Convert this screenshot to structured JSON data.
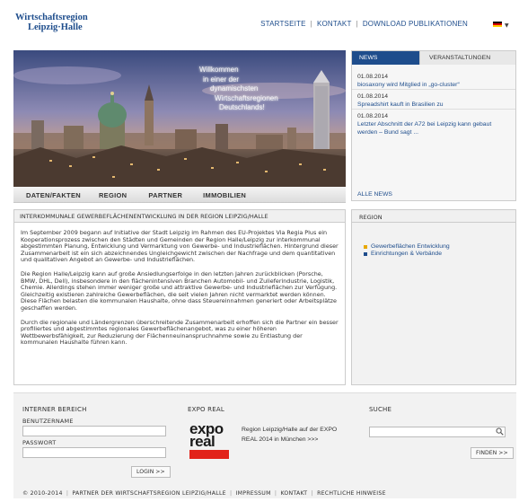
{
  "header": {
    "logo_line1": "Wirtschaftsregion",
    "logo_line2": "Leipzig·Halle",
    "nav": [
      "STARTSEITE",
      "KONTAKT",
      "DOWNLOAD PUBLIKATIONEN"
    ],
    "language_flag": "de-flag-icon"
  },
  "hero": {
    "text_lines": [
      "Willkommen",
      "in einer der",
      "dynamischsten",
      "Wirtschaftsregionen",
      "Deutschlands!"
    ],
    "nav": [
      "DATEN/FAKTEN",
      "REGION",
      "PARTNER",
      "IMMOBILIEN"
    ]
  },
  "news": {
    "tabs": [
      "NEWS",
      "VERANSTALTUNGEN"
    ],
    "items": [
      {
        "date": "01.08.2014",
        "text": "biosaxony wird Mitglied in „go-cluster“"
      },
      {
        "date": "01.08.2014",
        "text": "Spreadshirt kauft in Brasilien zu"
      },
      {
        "date": "01.08.2014",
        "text": "Letzter Abschnitt der A72 bei Leipzig kann gebaut werden – Bund sagt ..."
      }
    ],
    "all_link": "ALLE NEWS"
  },
  "content": {
    "title": "INTERKOMMUNALE GEWERBEFLÄCHENENTWICKLUNG IN DER REGION LEIPZIG/HALLE",
    "paragraphs": [
      "Im September 2009 begann auf Initiative der Stadt Leipzig im Rahmen des EU-Projektes Via Regia Plus ein Kooperationsprozess zwischen den Städten und Gemeinden der Region Halle/Leipzig zur interkommunal abgestimmten Planung, Entwicklung und Vermarktung von Gewerbe- und Industrieflächen. Hintergrund dieser Zusammenarbeit ist ein sich abzeichnendes Ungleichgewicht zwischen der Nachfrage und dem quantitativen und qualitativen Angebot an Gewerbe- und Industrieflächen.",
      "Die Region Halle/Leipzig kann auf große Ansiedlungserfolge in den letzten Jahren zurückblicken (Porsche, BMW, DHL, Dell), insbesondere in den flächenintensiven Branchen Automobil- und Zulieferindustrie, Logistik, Chemie. Allerdings stehen immer weniger große und attraktive Gewerbe- und Industrieflächen zur Verfügung. Gleichzeitig existieren zahlreiche Gewerbeflächen, die seit vielen Jahren nicht vermarktet werden können. Diese Flächen belasten die kommunalen Haushalte, ohne dass Steuereinnahmen generiert oder Arbeitsplätze geschaffen werden.",
      "Durch die regionale und Ländergrenzen überschreitende Zusammenarbeit erhoffen sich die Partner ein besser profiliertes und abgestimmtes regionales Gewerbeflächenangebot, was zu einer höheren Wettbewerbsfähigkeit, zur Reduzierung der Flächenneuinanspruchnahme sowie zu Entlastung der kommunalen Haushalte führen kann."
    ]
  },
  "region": {
    "title": "REGION",
    "links": [
      {
        "label": "Gewerbeflächen Entwicklung",
        "color": "#e8a800"
      },
      {
        "label": "Einrichtungen & Verbände",
        "color": "#1e4d8c"
      }
    ]
  },
  "footer": {
    "login": {
      "heading": "INTERNER BEREICH",
      "user_label": "BENUTZERNAME",
      "pass_label": "PASSWORT",
      "button": "LOGIN >>"
    },
    "expo": {
      "heading": "EXPO REAL",
      "logo_line1": "expo",
      "logo_line2": "real",
      "text": "Region Leipzig/Halle auf der EXPO REAL 2014 in München >>>"
    },
    "search": {
      "heading": "SUCHE",
      "button": "FINDEN >>"
    },
    "bottom": [
      "© 2010-2014",
      "PARTNER DER WIRTSCHAFTSREGION LEIPZIG/HALLE",
      "IMPRESSUM",
      "KONTAKT",
      "RECHTLICHE HINWEISE"
    ]
  },
  "colors": {
    "brand_blue": "#1e4d8c",
    "expo_red": "#e2231a"
  }
}
